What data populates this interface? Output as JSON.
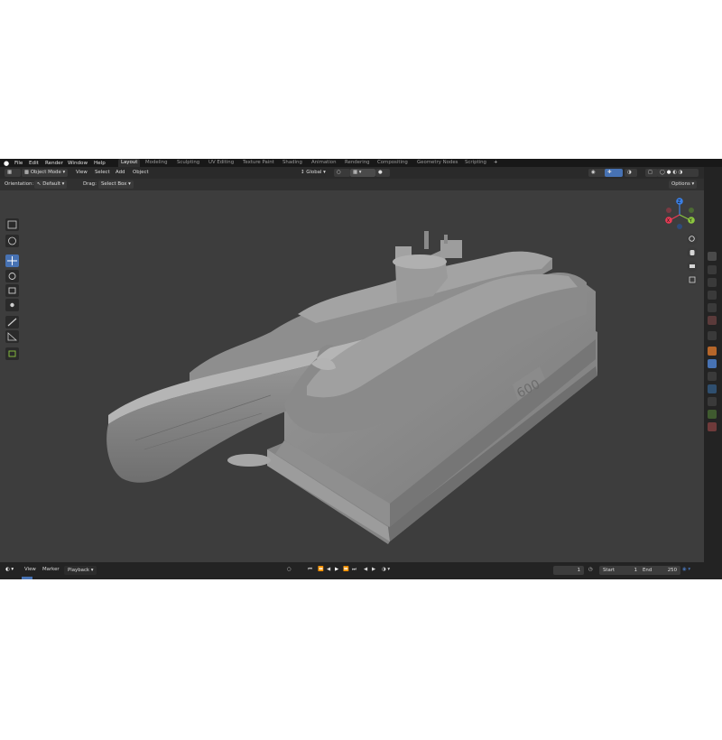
{
  "menu": {
    "items": [
      "File",
      "Edit",
      "Render",
      "Window",
      "Help"
    ]
  },
  "workspaces": {
    "tabs": [
      "Layout",
      "Modeling",
      "Sculpting",
      "UV Editing",
      "Texture Paint",
      "Shading",
      "Animation",
      "Rendering",
      "Compositing",
      "Geometry Nodes",
      "Scripting"
    ],
    "add_label": "+"
  },
  "header": {
    "mode": "Object Mode",
    "view": "View",
    "select": "Select",
    "add": "Add",
    "object": "Object",
    "transform_orientation": "Global"
  },
  "toolsettings": {
    "orientation_label": "Orientation:",
    "orientation_value": "Default",
    "drag_label": "Drag:",
    "drag_value": "Select Box",
    "options": "Options"
  },
  "gizmo": {
    "x": "X",
    "y": "Y",
    "z": "Z"
  },
  "model": {
    "plaque_text": "600"
  },
  "timeline": {
    "view": "View",
    "marker": "Marker",
    "playback": "Playback",
    "current_frame": "1",
    "start_label": "Start",
    "start_value": "1",
    "end_label": "End",
    "end_value": "250"
  },
  "colors": {
    "viewport_bg": "#3d3d3d",
    "active_blue": "#4772b3",
    "axis_x": "#e83b55",
    "axis_y": "#8bc53f",
    "axis_z": "#3a7fe5"
  }
}
